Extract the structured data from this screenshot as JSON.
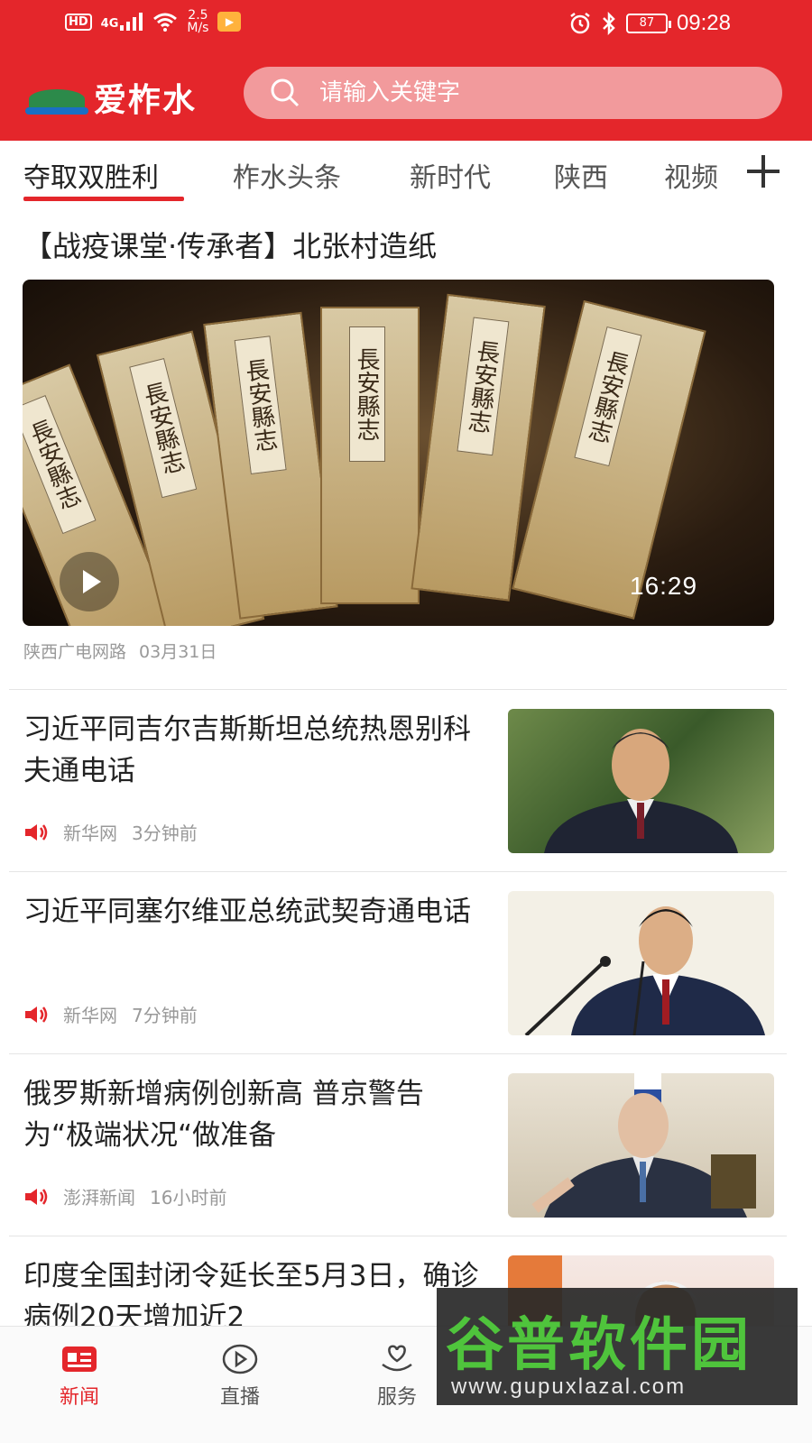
{
  "status_bar": {
    "hd": "HD",
    "network": "4G",
    "speed_value": "2.5",
    "speed_unit": "M/s",
    "battery": "87",
    "time": "09:28"
  },
  "header": {
    "logo_text": "爱柞水",
    "search_placeholder": "请输入关键字"
  },
  "tabs": [
    {
      "label": "夺取双胜利"
    },
    {
      "label": "柞水头条"
    },
    {
      "label": "新时代"
    },
    {
      "label": "陕西"
    },
    {
      "label": "视频"
    }
  ],
  "featured": {
    "title": "【战疫课堂·传承者】北张村造纸",
    "duration": "16:29",
    "source": "陕西广电网路",
    "date": "03月31日",
    "book_label": "長安縣志"
  },
  "news": [
    {
      "title": "习近平同吉尔吉斯斯坦总统热恩别科夫通电话",
      "source": "新华网",
      "time": "3分钟前"
    },
    {
      "title": "习近平同塞尔维亚总统武契奇通电话",
      "source": "新华网",
      "time": "7分钟前"
    },
    {
      "title": "俄罗斯新增病例创新高 普京警告为“极端状况“做准备",
      "source": "澎湃新闻",
      "time": "16小时前"
    },
    {
      "title": "印度全国封闭令延长至5月3日，确诊病例20天增加近2",
      "source": "",
      "time": ""
    }
  ],
  "bottom_nav": [
    {
      "label": "新闻",
      "icon": "news-icon"
    },
    {
      "label": "直播",
      "icon": "play-icon"
    },
    {
      "label": "服务",
      "icon": "heart-hand-icon"
    }
  ],
  "watermark": {
    "title": "谷普软件园",
    "url": "www.gupuxlazal.com"
  },
  "colors": {
    "brand_red": "#e4262b",
    "watermark_green": "#4fc43c"
  }
}
